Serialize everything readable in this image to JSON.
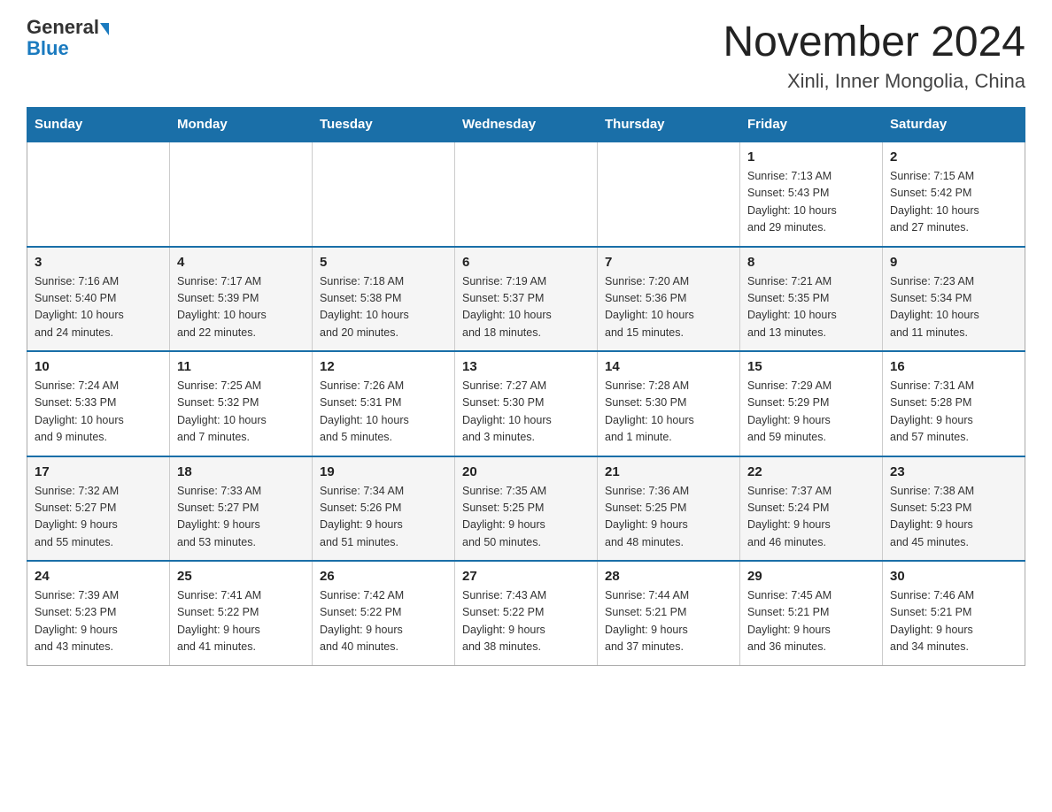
{
  "header": {
    "logo_general": "General",
    "logo_blue": "Blue",
    "main_title": "November 2024",
    "subtitle": "Xinli, Inner Mongolia, China"
  },
  "weekdays": [
    "Sunday",
    "Monday",
    "Tuesday",
    "Wednesday",
    "Thursday",
    "Friday",
    "Saturday"
  ],
  "weeks": [
    {
      "days": [
        {
          "day": "",
          "info": ""
        },
        {
          "day": "",
          "info": ""
        },
        {
          "day": "",
          "info": ""
        },
        {
          "day": "",
          "info": ""
        },
        {
          "day": "",
          "info": ""
        },
        {
          "day": "1",
          "info": "Sunrise: 7:13 AM\nSunset: 5:43 PM\nDaylight: 10 hours\nand 29 minutes."
        },
        {
          "day": "2",
          "info": "Sunrise: 7:15 AM\nSunset: 5:42 PM\nDaylight: 10 hours\nand 27 minutes."
        }
      ]
    },
    {
      "days": [
        {
          "day": "3",
          "info": "Sunrise: 7:16 AM\nSunset: 5:40 PM\nDaylight: 10 hours\nand 24 minutes."
        },
        {
          "day": "4",
          "info": "Sunrise: 7:17 AM\nSunset: 5:39 PM\nDaylight: 10 hours\nand 22 minutes."
        },
        {
          "day": "5",
          "info": "Sunrise: 7:18 AM\nSunset: 5:38 PM\nDaylight: 10 hours\nand 20 minutes."
        },
        {
          "day": "6",
          "info": "Sunrise: 7:19 AM\nSunset: 5:37 PM\nDaylight: 10 hours\nand 18 minutes."
        },
        {
          "day": "7",
          "info": "Sunrise: 7:20 AM\nSunset: 5:36 PM\nDaylight: 10 hours\nand 15 minutes."
        },
        {
          "day": "8",
          "info": "Sunrise: 7:21 AM\nSunset: 5:35 PM\nDaylight: 10 hours\nand 13 minutes."
        },
        {
          "day": "9",
          "info": "Sunrise: 7:23 AM\nSunset: 5:34 PM\nDaylight: 10 hours\nand 11 minutes."
        }
      ]
    },
    {
      "days": [
        {
          "day": "10",
          "info": "Sunrise: 7:24 AM\nSunset: 5:33 PM\nDaylight: 10 hours\nand 9 minutes."
        },
        {
          "day": "11",
          "info": "Sunrise: 7:25 AM\nSunset: 5:32 PM\nDaylight: 10 hours\nand 7 minutes."
        },
        {
          "day": "12",
          "info": "Sunrise: 7:26 AM\nSunset: 5:31 PM\nDaylight: 10 hours\nand 5 minutes."
        },
        {
          "day": "13",
          "info": "Sunrise: 7:27 AM\nSunset: 5:30 PM\nDaylight: 10 hours\nand 3 minutes."
        },
        {
          "day": "14",
          "info": "Sunrise: 7:28 AM\nSunset: 5:30 PM\nDaylight: 10 hours\nand 1 minute."
        },
        {
          "day": "15",
          "info": "Sunrise: 7:29 AM\nSunset: 5:29 PM\nDaylight: 9 hours\nand 59 minutes."
        },
        {
          "day": "16",
          "info": "Sunrise: 7:31 AM\nSunset: 5:28 PM\nDaylight: 9 hours\nand 57 minutes."
        }
      ]
    },
    {
      "days": [
        {
          "day": "17",
          "info": "Sunrise: 7:32 AM\nSunset: 5:27 PM\nDaylight: 9 hours\nand 55 minutes."
        },
        {
          "day": "18",
          "info": "Sunrise: 7:33 AM\nSunset: 5:27 PM\nDaylight: 9 hours\nand 53 minutes."
        },
        {
          "day": "19",
          "info": "Sunrise: 7:34 AM\nSunset: 5:26 PM\nDaylight: 9 hours\nand 51 minutes."
        },
        {
          "day": "20",
          "info": "Sunrise: 7:35 AM\nSunset: 5:25 PM\nDaylight: 9 hours\nand 50 minutes."
        },
        {
          "day": "21",
          "info": "Sunrise: 7:36 AM\nSunset: 5:25 PM\nDaylight: 9 hours\nand 48 minutes."
        },
        {
          "day": "22",
          "info": "Sunrise: 7:37 AM\nSunset: 5:24 PM\nDaylight: 9 hours\nand 46 minutes."
        },
        {
          "day": "23",
          "info": "Sunrise: 7:38 AM\nSunset: 5:23 PM\nDaylight: 9 hours\nand 45 minutes."
        }
      ]
    },
    {
      "days": [
        {
          "day": "24",
          "info": "Sunrise: 7:39 AM\nSunset: 5:23 PM\nDaylight: 9 hours\nand 43 minutes."
        },
        {
          "day": "25",
          "info": "Sunrise: 7:41 AM\nSunset: 5:22 PM\nDaylight: 9 hours\nand 41 minutes."
        },
        {
          "day": "26",
          "info": "Sunrise: 7:42 AM\nSunset: 5:22 PM\nDaylight: 9 hours\nand 40 minutes."
        },
        {
          "day": "27",
          "info": "Sunrise: 7:43 AM\nSunset: 5:22 PM\nDaylight: 9 hours\nand 38 minutes."
        },
        {
          "day": "28",
          "info": "Sunrise: 7:44 AM\nSunset: 5:21 PM\nDaylight: 9 hours\nand 37 minutes."
        },
        {
          "day": "29",
          "info": "Sunrise: 7:45 AM\nSunset: 5:21 PM\nDaylight: 9 hours\nand 36 minutes."
        },
        {
          "day": "30",
          "info": "Sunrise: 7:46 AM\nSunset: 5:21 PM\nDaylight: 9 hours\nand 34 minutes."
        }
      ]
    }
  ]
}
